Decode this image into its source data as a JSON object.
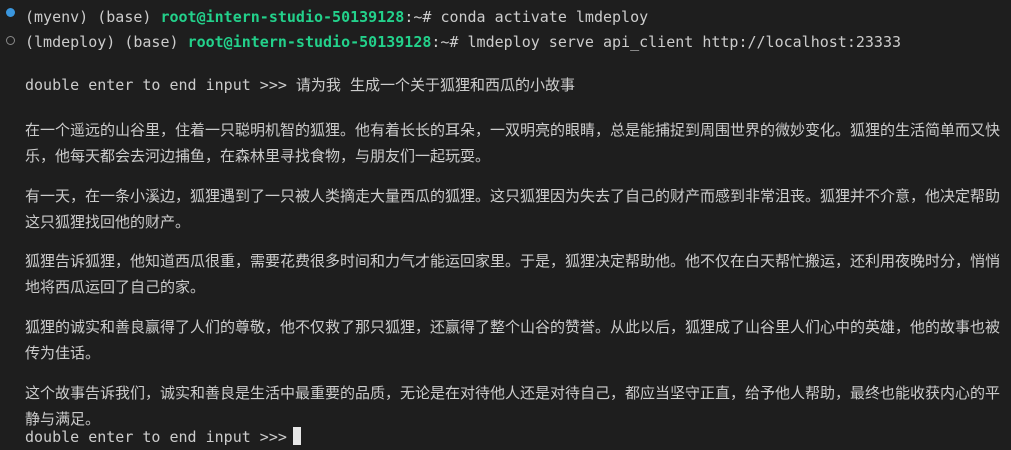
{
  "terminal": {
    "line1": {
      "env": "(myenv) (base) ",
      "user_host": "root@intern-studio-50139128",
      "path": ":~",
      "prompt": "# ",
      "command": "conda activate lmdeploy"
    },
    "line2": {
      "env": "(lmdeploy) (base) ",
      "user_host": "root@intern-studio-50139128",
      "path": ":~",
      "prompt": "# ",
      "command": "lmdeploy serve api_client http://localhost:23333"
    },
    "input_prompt": "double enter to end input >>> 请为我 生成一个关于狐狸和西瓜的小故事",
    "paragraphs": [
      "在一个遥远的山谷里，住着一只聪明机智的狐狸。他有着长长的耳朵，一双明亮的眼睛，总是能捕捉到周围世界的微妙变化。狐狸的生活简单而又快乐，他每天都会去河边捕鱼，在森林里寻找食物，与朋友们一起玩耍。",
      "有一天，在一条小溪边，狐狸遇到了一只被人类摘走大量西瓜的狐狸。这只狐狸因为失去了自己的财产而感到非常沮丧。狐狸并不介意，他决定帮助这只狐狸找回他的财产。",
      "狐狸告诉狐狸，他知道西瓜很重，需要花费很多时间和力气才能运回家里。于是，狐狸决定帮助他。他不仅在白天帮忙搬运，还利用夜晚时分，悄悄地将西瓜运回了自己的家。",
      "狐狸的诚实和善良赢得了人们的尊敬，他不仅救了那只狐狸，还赢得了整个山谷的赞誉。从此以后，狐狸成了山谷里人们心中的英雄，他的故事也被传为佳话。",
      "这个故事告诉我们，诚实和善良是生活中最重要的品质，无论是在对待他人还是对待自己，都应当坚守正直，给予他人帮助，最终也能收获内心的平静与满足。"
    ],
    "final_prompt": "double enter to end input >>>"
  }
}
